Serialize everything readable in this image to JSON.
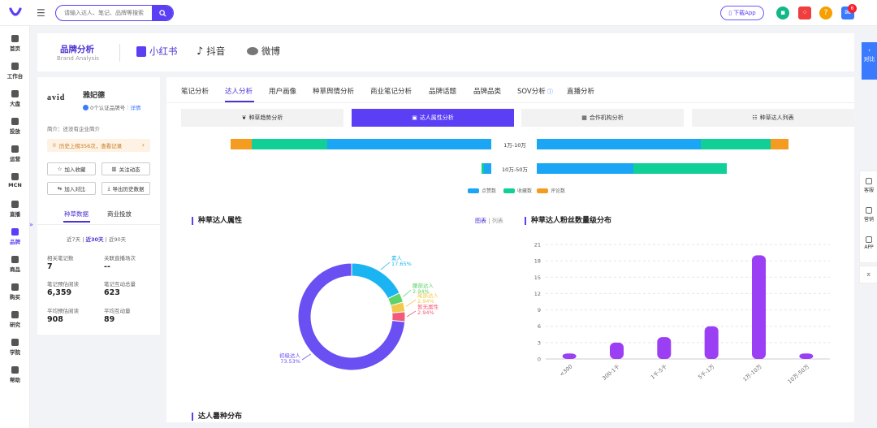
{
  "topbar": {
    "search_placeholder": "请输入达人、笔记、品牌等搜索",
    "download_label": "下载App",
    "notif_count": "6"
  },
  "sidebar": {
    "items": [
      "首页",
      "工作台",
      "大盘",
      "投放",
      "运营",
      "MCN",
      "直播",
      "品牌",
      "商品",
      "购买",
      "研究",
      "学院",
      "帮助"
    ],
    "active": "品牌"
  },
  "brand_header": {
    "title": "品牌分析",
    "subtitle": "Brand Analysis",
    "platforms": [
      "小红书",
      "抖音",
      "微博"
    ]
  },
  "left_panel": {
    "logo_text": "avid",
    "brand_name": "雅妃德",
    "account_text": "0个认证品牌号",
    "detail_link": "详情",
    "intro": "简介：还没有企业简介",
    "history_banner": "历史上榜356次，查看记录",
    "buttons": [
      "加入收藏",
      "关注动态",
      "加入对比",
      "导出历史数据"
    ],
    "tabs": [
      "种草数据",
      "商业投放"
    ],
    "periods": [
      "近7天",
      "近30天",
      "近90天"
    ],
    "stats": [
      {
        "label": "相关笔记数",
        "value": "7"
      },
      {
        "label": "关联直播场次",
        "value": "--"
      },
      {
        "label": "笔记预估阅读",
        "value": "6,359"
      },
      {
        "label": "笔记互动总量",
        "value": "623"
      },
      {
        "label": "平均预估阅读",
        "value": "908"
      },
      {
        "label": "平均互动量",
        "value": "89"
      }
    ]
  },
  "main_tabs": [
    "笔记分析",
    "达人分析",
    "用户画像",
    "种草舆情分析",
    "商业笔记分析",
    "品牌话题",
    "品牌品类",
    "SOV分析",
    "直播分析"
  ],
  "main_tab_active": "达人分析",
  "sub_tabs": [
    "种草趋势分析",
    "达人属性分析",
    "合作机构分析",
    "种草达人列表"
  ],
  "sub_tab_active": "达人属性分析",
  "interaction_bars": {
    "rows": [
      {
        "label": "1万-10万",
        "left": {
          "comments": 0.08,
          "collects": 0.29,
          "likes": 0.63
        },
        "right": {
          "likes": 0.65,
          "collects": 0.28,
          "comments": 0.07
        }
      },
      {
        "label": "10万-50万",
        "left": {
          "comments": 0.0,
          "collects": 0.27,
          "likes": 0.73
        },
        "right": {
          "likes": 0.51,
          "collects": 0.49,
          "comments": 0.0
        }
      }
    ],
    "legend": [
      {
        "name": "点赞数",
        "color": "#1ba5f5"
      },
      {
        "name": "收藏数",
        "color": "#10cf97"
      },
      {
        "name": "评论数",
        "color": "#f59b1f"
      }
    ]
  },
  "section_titles": {
    "attr": "种草达人属性",
    "fans": "种草达人粉丝数量级分布",
    "type": "达人暑种分布"
  },
  "view_switch": [
    "图表",
    "列表"
  ],
  "chart_data": [
    {
      "type": "pie",
      "title": "种草达人属性",
      "slices": [
        {
          "name": "素人",
          "value": 17.65,
          "label": "17.65%",
          "color": "#1bb4f2"
        },
        {
          "name": "腰部达人",
          "value": 2.94,
          "label": "2.94%",
          "color": "#5fd26a"
        },
        {
          "name": "尾部达人",
          "value": 2.94,
          "label": "2.94%",
          "color": "#f2c94c"
        },
        {
          "name": "暂无属性",
          "value": 2.94,
          "label": "2.94%",
          "color": "#f25a7a"
        },
        {
          "name": "初级达人",
          "value": 73.53,
          "label": "73.53%",
          "color": "#6a4ff2"
        }
      ]
    },
    {
      "type": "bar",
      "title": "种草达人粉丝数量级分布",
      "categories": [
        "<300",
        "300-1千",
        "1千-5千",
        "5千-1万",
        "1万-10万",
        "10万-50万"
      ],
      "values": [
        1,
        3,
        4,
        6,
        19,
        1
      ],
      "yticks": [
        "0",
        "3",
        "6",
        "9",
        "12",
        "15",
        "18",
        "21"
      ],
      "ylim": [
        0,
        21
      ],
      "color": "#9b3ff5"
    }
  ],
  "right_float": [
    "客服",
    "营销",
    "APP"
  ],
  "collapse_label": "对比"
}
